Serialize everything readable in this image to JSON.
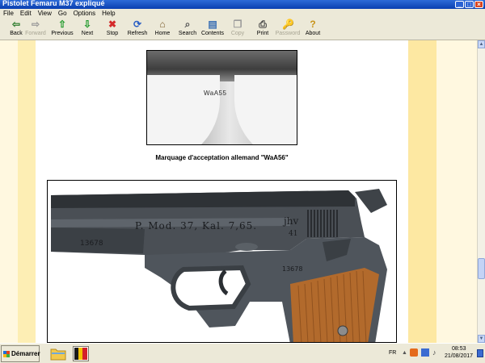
{
  "window": {
    "title": "Pistolet Femaru M37 expliqué",
    "min": "_",
    "max": "□",
    "close": "×"
  },
  "menu": [
    "File",
    "Edit",
    "View",
    "Go",
    "Options",
    "Help"
  ],
  "toolbar": [
    {
      "label": "Back",
      "icon": "arrow-left-icon",
      "glyph": "⇦",
      "color": "#2a7a2a",
      "enabled": true
    },
    {
      "label": "Forward",
      "icon": "arrow-right-icon",
      "glyph": "⇨",
      "color": "#9a9a9a",
      "enabled": false
    },
    {
      "label": "Previous",
      "icon": "arrow-up-icon",
      "glyph": "⇧",
      "color": "#1f9a2a",
      "enabled": true
    },
    {
      "label": "Next",
      "icon": "arrow-down-icon",
      "glyph": "⇩",
      "color": "#1f9a2a",
      "enabled": true
    },
    {
      "label": "Stop",
      "icon": "stop-icon",
      "glyph": "✖",
      "color": "#d42a2a",
      "enabled": true
    },
    {
      "label": "Refresh",
      "icon": "refresh-icon",
      "glyph": "⟳",
      "color": "#2b5fc4",
      "enabled": true
    },
    {
      "label": "Home",
      "icon": "home-icon",
      "glyph": "⌂",
      "color": "#7a5a2a",
      "enabled": true
    },
    {
      "label": "Search",
      "icon": "search-icon",
      "glyph": "⌕",
      "color": "#555555",
      "enabled": true
    },
    {
      "label": "Contents",
      "icon": "contents-icon",
      "glyph": "▤",
      "color": "#3a6fb4",
      "enabled": true
    },
    {
      "label": "Copy",
      "icon": "copy-icon",
      "glyph": "❐",
      "color": "#9a9a9a",
      "enabled": false
    },
    {
      "label": "Print",
      "icon": "print-icon",
      "glyph": "⎙",
      "color": "#444444",
      "enabled": true
    },
    {
      "label": "Password",
      "icon": "password-icon",
      "glyph": "🔑",
      "color": "#9a9a9a",
      "enabled": false
    },
    {
      "label": "About",
      "icon": "about-icon",
      "glyph": "?",
      "color": "#c8941a",
      "enabled": true
    }
  ],
  "content": {
    "stamp_text": "WaA55",
    "caption": "Marquage d'acceptation allemand \"WaA56\"",
    "slide_text": "P. Mod. 37, Kal. 7,65.",
    "maker_code": "jhv",
    "year_code": "41",
    "serial_front": "13678",
    "serial_frame": "13678"
  },
  "taskbar": {
    "start_label": "Démarrer",
    "lang": "FR",
    "time": "08:53",
    "date": "21/08/2017"
  }
}
